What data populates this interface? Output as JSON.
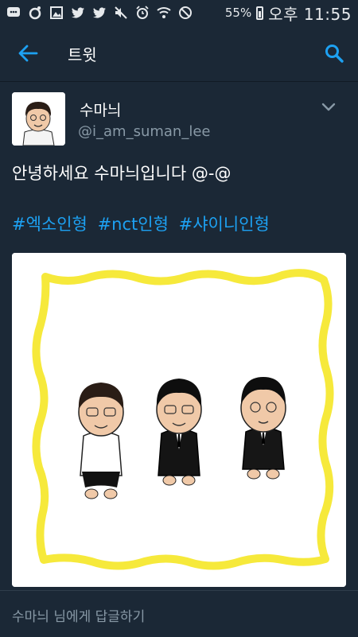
{
  "status_bar": {
    "icons": [
      "chat-icon",
      "record-icon",
      "gallery-icon",
      "twitter-icon",
      "twitter-icon",
      "mute-icon",
      "alarm-icon",
      "wifi-icon",
      "blocked-icon"
    ],
    "battery": "55%",
    "time": "오후 11:55"
  },
  "app_bar": {
    "title": "트윗"
  },
  "tweet": {
    "author_name": "수마늬",
    "author_handle": "@i_am_suman_lee",
    "text": "안녕하세요 수마늬입니다 @-@",
    "hashtags": [
      "#엑소인형",
      "#nct인형",
      "#샤이니인형"
    ]
  },
  "reply": {
    "placeholder": "수마늬 님에게 답글하기"
  },
  "colors": {
    "background": "#1b2836",
    "accent": "#1da1f2",
    "secondary_text": "#8899a6",
    "frame_yellow": "#f6e93b"
  }
}
